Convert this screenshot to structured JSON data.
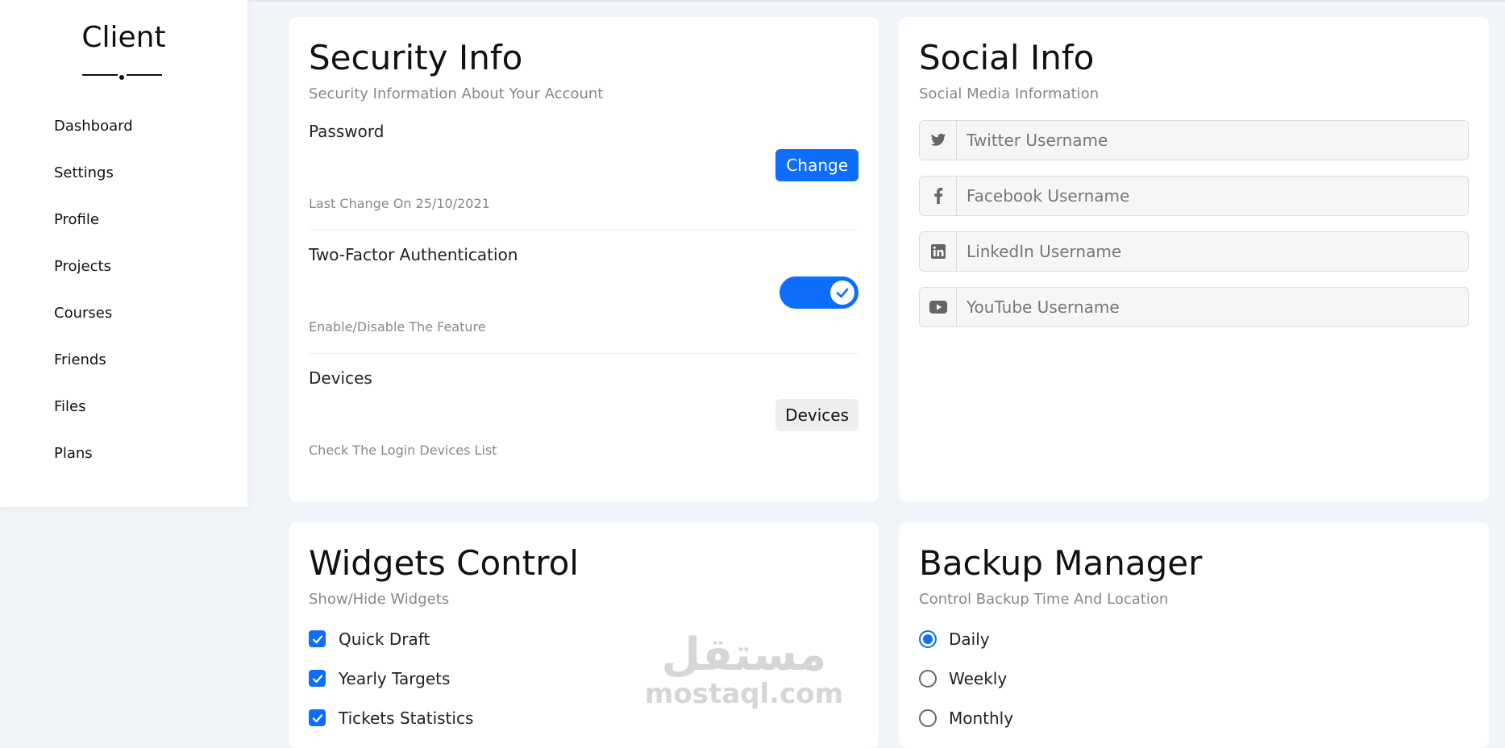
{
  "sidebar": {
    "brand": "Client",
    "items": [
      {
        "label": "Dashboard"
      },
      {
        "label": "Settings"
      },
      {
        "label": "Profile"
      },
      {
        "label": "Projects"
      },
      {
        "label": "Courses"
      },
      {
        "label": "Friends"
      },
      {
        "label": "Files"
      },
      {
        "label": "Plans"
      }
    ]
  },
  "security": {
    "title": "Security Info",
    "subtitle": "Security Information About Your Account",
    "password": {
      "label": "Password",
      "button": "Change",
      "note": "Last Change On 25/10/2021"
    },
    "twofa": {
      "label": "Two-Factor Authentication",
      "note": "Enable/Disable The Feature",
      "enabled": true
    },
    "devices": {
      "label": "Devices",
      "button": "Devices",
      "note": "Check The Login Devices List"
    }
  },
  "social": {
    "title": "Social Info",
    "subtitle": "Social Media Information",
    "fields": [
      {
        "icon": "twitter-icon",
        "placeholder": "Twitter Username"
      },
      {
        "icon": "facebook-icon",
        "placeholder": "Facebook Username"
      },
      {
        "icon": "linkedin-icon",
        "placeholder": "LinkedIn Username"
      },
      {
        "icon": "youtube-icon",
        "placeholder": "YouTube Username"
      }
    ]
  },
  "widgets": {
    "title": "Widgets Control",
    "subtitle": "Show/Hide Widgets",
    "items": [
      {
        "label": "Quick Draft",
        "checked": true
      },
      {
        "label": "Yearly Targets",
        "checked": true
      },
      {
        "label": "Tickets Statistics",
        "checked": true
      }
    ]
  },
  "watermark": {
    "arabic": "مستقل",
    "latin": "mostaql.com"
  },
  "backup": {
    "title": "Backup Manager",
    "subtitle": "Control Backup Time And Location",
    "options": [
      {
        "label": "Daily",
        "selected": true
      },
      {
        "label": "Weekly",
        "selected": false
      },
      {
        "label": "Monthly",
        "selected": false
      }
    ]
  },
  "colors": {
    "accent": "#0d6efd",
    "background": "#f1f4f9",
    "icon_gray": "#666666"
  }
}
